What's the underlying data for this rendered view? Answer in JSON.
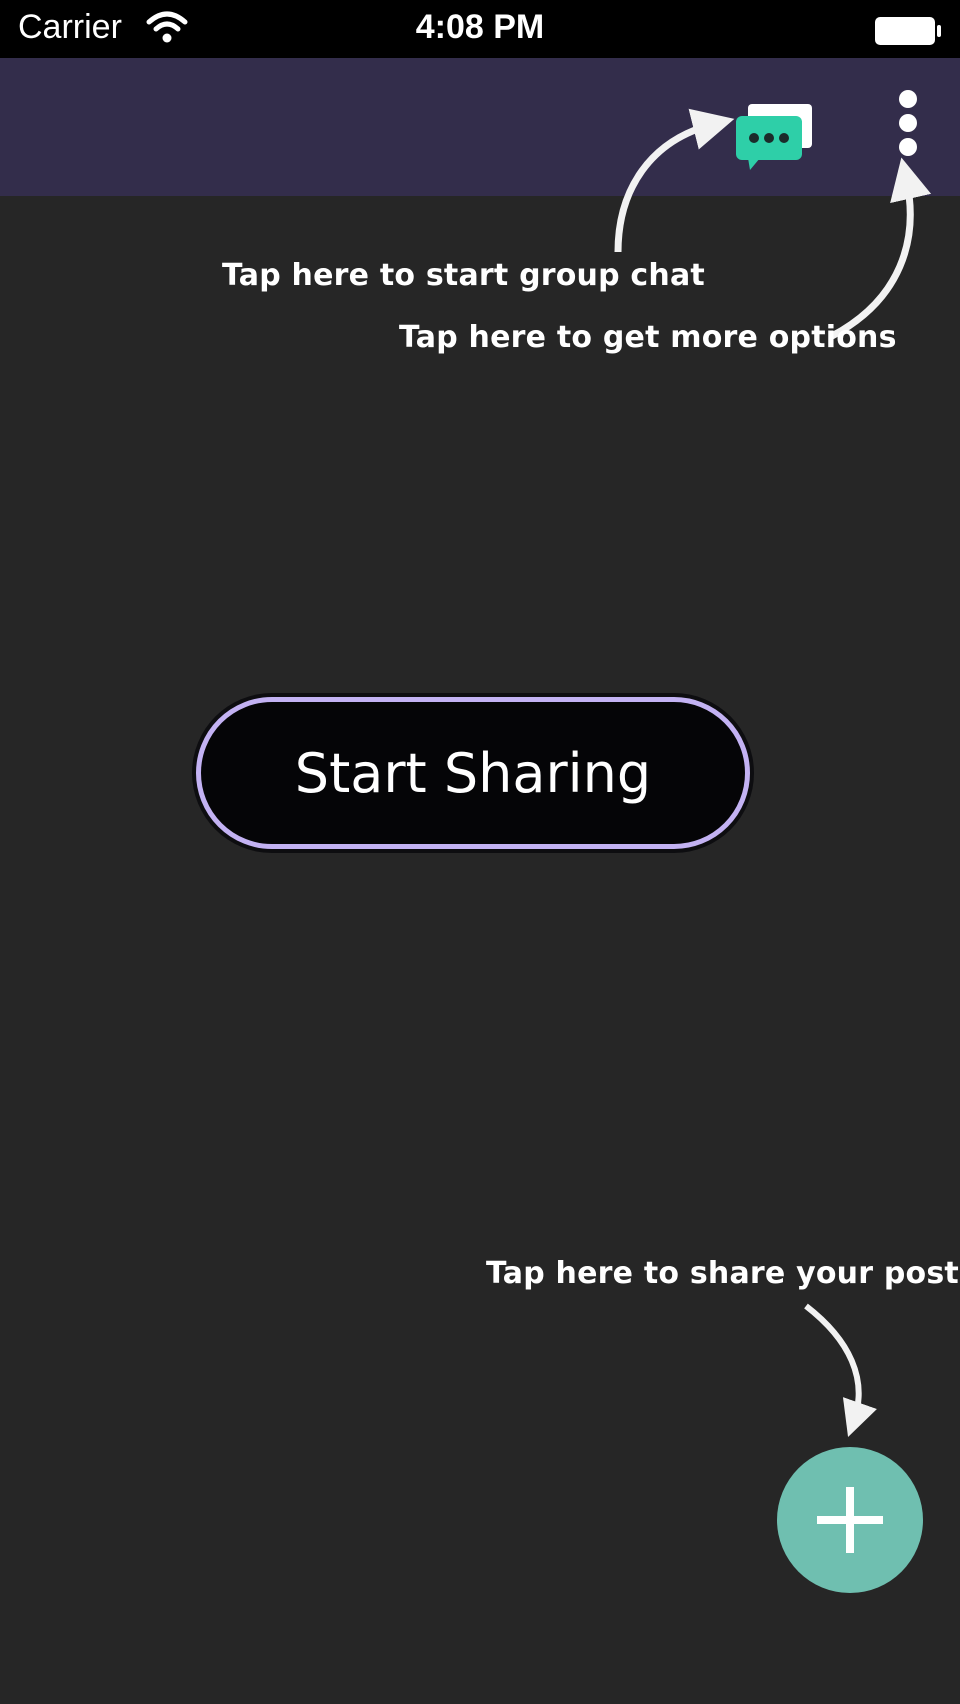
{
  "status_bar": {
    "carrier": "Carrier",
    "time": "4:08 PM",
    "wifi_icon": "wifi-icon",
    "battery_icon": "battery-icon"
  },
  "app_bar": {
    "background": "#332d4b",
    "chat_icon": "chat-bubbles-icon",
    "chat_icon_color": "#2ecfa8",
    "more_icon": "more-vertical-icon"
  },
  "hints": {
    "group_chat": "Tap here to start group chat",
    "more_options": "Tap here to get more options",
    "share_posts": "Tap here to share your posts"
  },
  "main": {
    "start_button_label": "Start Sharing",
    "start_button_border": "#c3b2f3"
  },
  "fab": {
    "icon": "plus-icon",
    "color": "#6fbfb0"
  }
}
